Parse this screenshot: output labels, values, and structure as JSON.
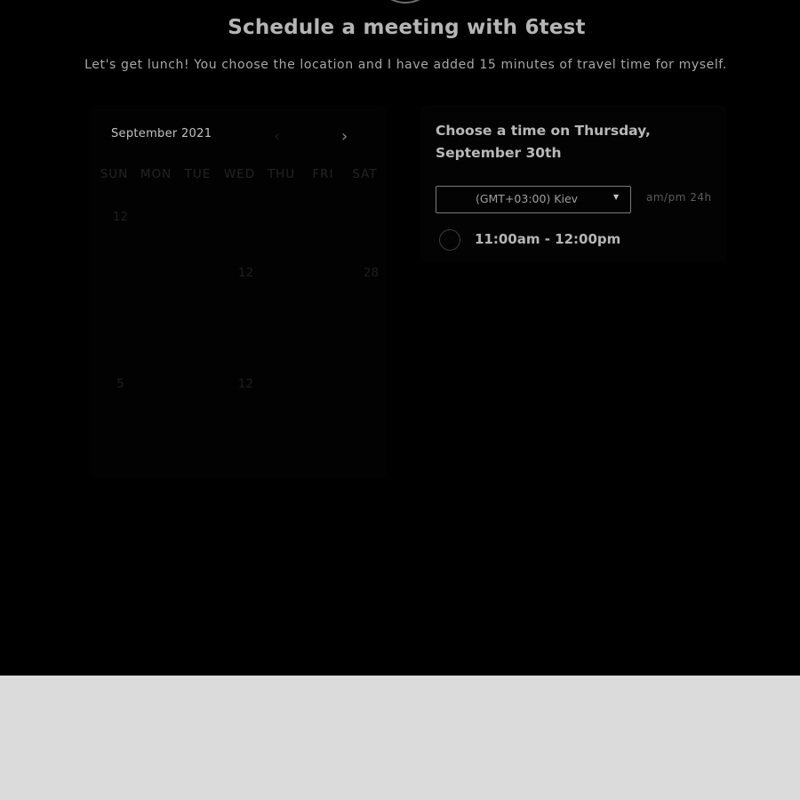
{
  "page": {
    "title": "Schedule a meeting with 6test",
    "description": "Let's get lunch! You choose the location and I have added 15 minutes of travel time for myself."
  },
  "calendar": {
    "month_label": "September 2021",
    "prev_icon": "chevron-left-icon",
    "next_icon": "chevron-right-icon",
    "prev_glyph": "‹",
    "next_glyph": "›",
    "weekdays": [
      "SUN",
      "MON",
      "TUE",
      "WED",
      "THU",
      "FRI",
      "SAT"
    ],
    "visible_days": [
      "12",
      "12",
      "28",
      "5",
      "12"
    ]
  },
  "times": {
    "heading": "Choose a time on Thursday, September 30th",
    "timezone": "(GMT+03:00) Kiev",
    "format_ampm": "am/pm",
    "format_24h": "24h",
    "slots": [
      "11:00am - 12:00pm"
    ]
  },
  "colors": {
    "background": "#000000",
    "footer": "#dbdbdb",
    "text_primary": "#b5b5b5"
  }
}
